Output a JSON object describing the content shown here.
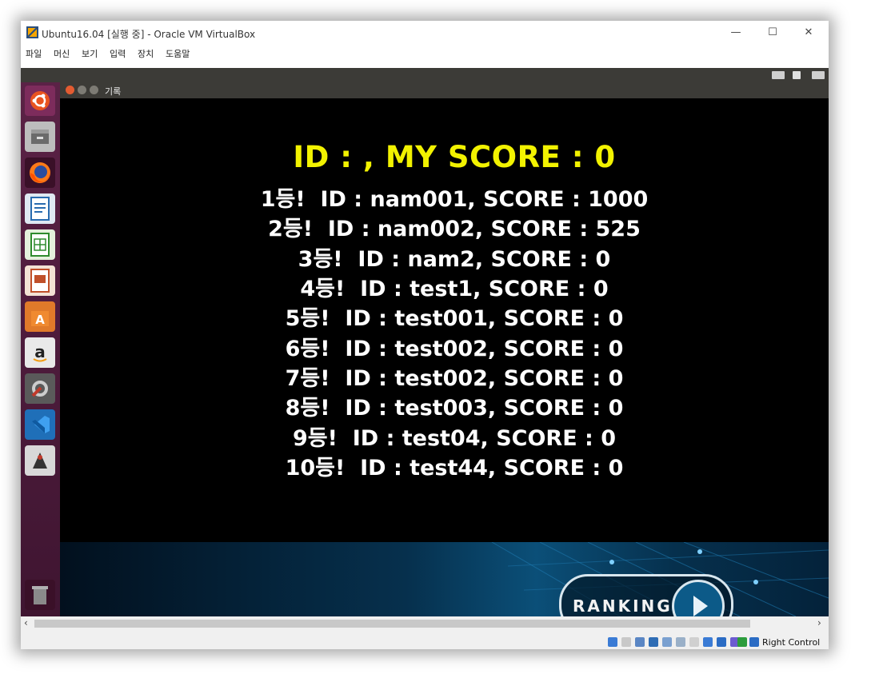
{
  "window": {
    "title": "Ubuntu16.04 [실행 중] - Oracle VM VirtualBox",
    "minimize": "—",
    "maximize": "☐",
    "close": "✕"
  },
  "menu": [
    "파일",
    "머신",
    "보기",
    "입력",
    "장치",
    "도움말"
  ],
  "app": {
    "window_title": "기록"
  },
  "score": {
    "my_score_line": "ID : ,    MY SCORE : 0",
    "rankings": [
      "1등!  ID : nam001, SCORE : 1000",
      "2등!  ID : nam002, SCORE : 525",
      "3등!  ID : nam2, SCORE : 0",
      "4등!  ID : test1, SCORE : 0",
      "5등!  ID : test001, SCORE : 0",
      "6등!  ID : test002, SCORE : 0",
      "7등!  ID : test002, SCORE : 0",
      "8등!  ID : test003, SCORE : 0",
      "9등!  ID : test04, SCORE : 0",
      "10등!  ID : test44, SCORE : 0"
    ]
  },
  "ranking_button": {
    "label": "RANKING"
  },
  "statusbar": {
    "host_key": "Right Control"
  },
  "colors": {
    "my_score": "#f2f200",
    "rank_text": "#ffffff",
    "launcher": "#4e1c3d"
  },
  "launcher_icons": [
    "ubuntu-dash-icon",
    "files-icon",
    "firefox-icon",
    "writer-icon",
    "calc-icon",
    "impress-icon",
    "software-center-icon",
    "amazon-icon",
    "settings-icon",
    "vscode-icon",
    "java-app-icon",
    "trash-icon"
  ]
}
